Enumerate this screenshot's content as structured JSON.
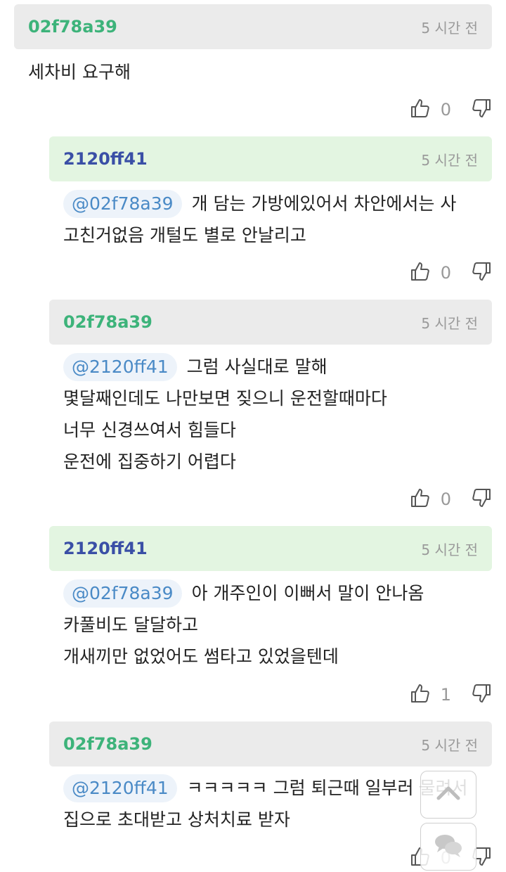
{
  "comments": [
    {
      "user": "02f78a39",
      "time": "5 시간 전",
      "mention": "",
      "lines": [
        "세차비 요구해"
      ],
      "likes": "0"
    },
    {
      "user": "2120ff41",
      "time": "5 시간 전",
      "mention": "@02f78a39",
      "lines": [
        "개 담는 가방에있어서 차안에서는 사",
        "고친거없음 개털도 별로 안날리고"
      ],
      "likes": "0"
    },
    {
      "user": "02f78a39",
      "time": "5 시간 전",
      "mention": "@2120ff41",
      "lines": [
        "그럼 사실대로 말해",
        "몇달째인데도 나만보면 짖으니 운전할때마다",
        "너무 신경쓰여서 힘들다",
        "운전에 집중하기 어렵다"
      ],
      "likes": "0"
    },
    {
      "user": "2120ff41",
      "time": "5 시간 전",
      "mention": "@02f78a39",
      "lines": [
        "아 개주인이 이뻐서 말이 안나옴",
        "카풀비도 달달하고",
        "개새끼만 없었어도 썸타고 있었을텐데"
      ],
      "likes": "1"
    },
    {
      "user": "02f78a39",
      "time": "5 시간 전",
      "mention": "@2120ff41",
      "lines": [
        "ㅋㅋㅋㅋㅋ 그럼 퇴근때 일부러 물려서",
        "집으로 초대받고 상처치료 받자"
      ],
      "likes": "0"
    }
  ],
  "colors": {
    "user_a": "#3db37a",
    "user_b": "#3a4fa6",
    "header_gray": "#ebebeb",
    "header_green": "#e3f5e1",
    "mention_text": "#4a8ac6"
  },
  "icons": [
    "thumbs-up-icon",
    "thumbs-down-icon",
    "chevron-up-icon",
    "chat-bubbles-icon"
  ]
}
